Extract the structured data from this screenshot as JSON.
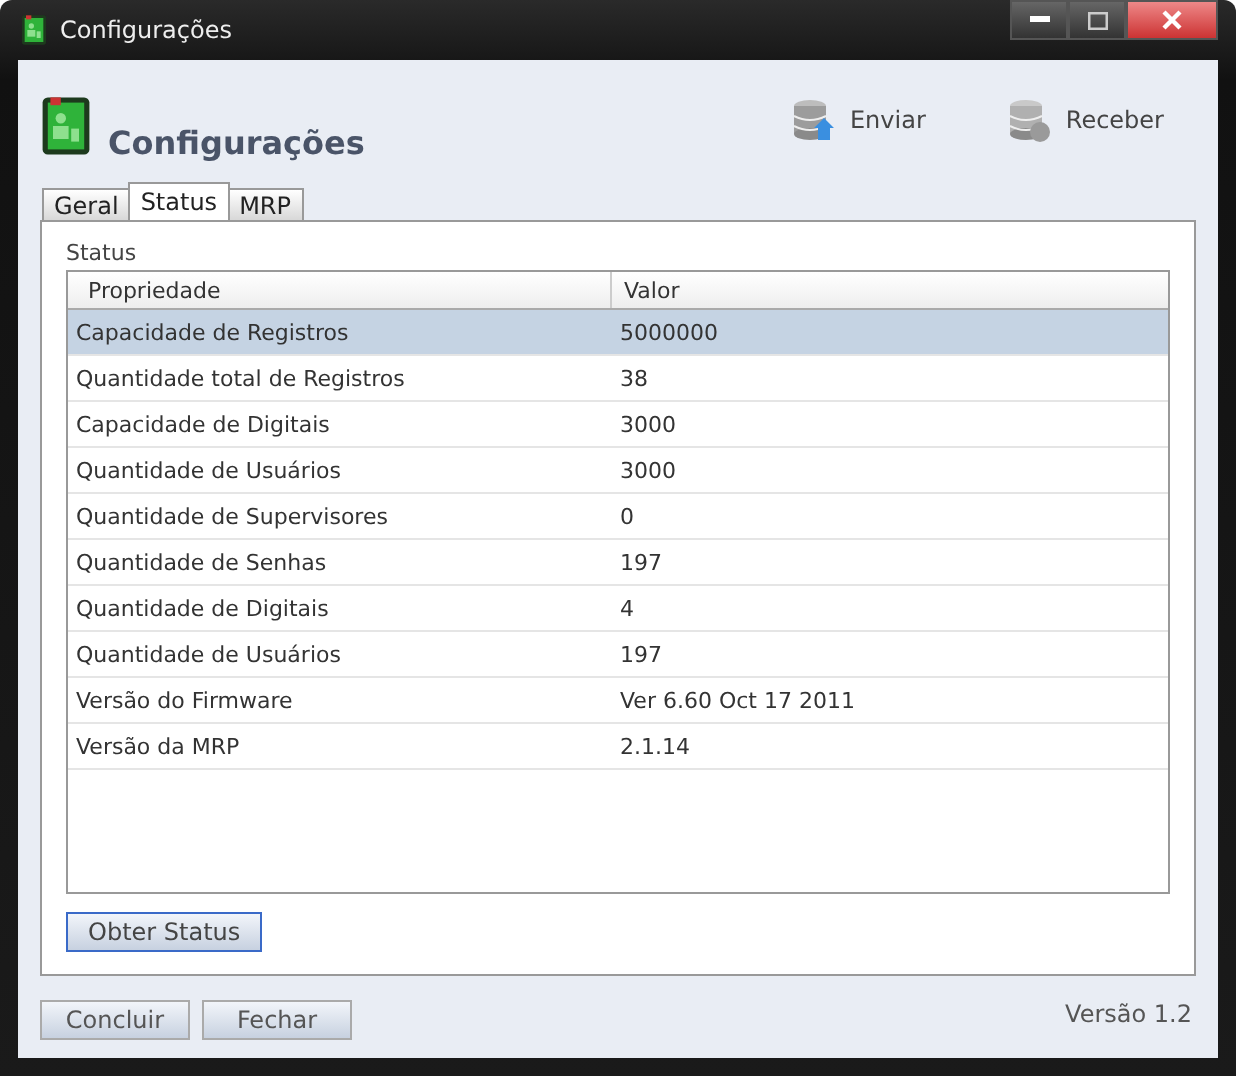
{
  "window": {
    "title": "Configurações"
  },
  "header": {
    "title": "Configurações",
    "actions": [
      {
        "label": "Enviar",
        "kind": "upload"
      },
      {
        "label": "Receber",
        "kind": "download"
      }
    ]
  },
  "tabs": [
    {
      "label": "Geral",
      "selected": false
    },
    {
      "label": "Status",
      "selected": true
    },
    {
      "label": "MRP",
      "selected": false
    }
  ],
  "panel": {
    "title": "Status"
  },
  "table": {
    "columns": [
      "Propriedade",
      "Valor"
    ],
    "rows": [
      {
        "cells": [
          "Capacidade de Registros",
          "5000000"
        ],
        "selected": true
      },
      {
        "cells": [
          "Quantidade total de Registros",
          "38"
        ],
        "selected": false
      },
      {
        "cells": [
          "Capacidade de Digitais",
          "3000"
        ],
        "selected": false
      },
      {
        "cells": [
          "Quantidade de Usuários",
          "3000"
        ],
        "selected": false
      },
      {
        "cells": [
          "Quantidade de Supervisores",
          "0"
        ],
        "selected": false
      },
      {
        "cells": [
          "Quantidade de Senhas",
          "197"
        ],
        "selected": false
      },
      {
        "cells": [
          "Quantidade de Digitais",
          "4"
        ],
        "selected": false
      },
      {
        "cells": [
          "Quantidade de Usuários",
          "197"
        ],
        "selected": false
      },
      {
        "cells": [
          "Versão do Firmware",
          "Ver 6.60 Oct 17 2011"
        ],
        "selected": false
      },
      {
        "cells": [
          "Versão da MRP",
          "2.1.14"
        ],
        "selected": false
      }
    ]
  },
  "panel_button": "Obter Status",
  "buttons": [
    "Concluir",
    "Fechar"
  ],
  "version": "Versão 1.2"
}
